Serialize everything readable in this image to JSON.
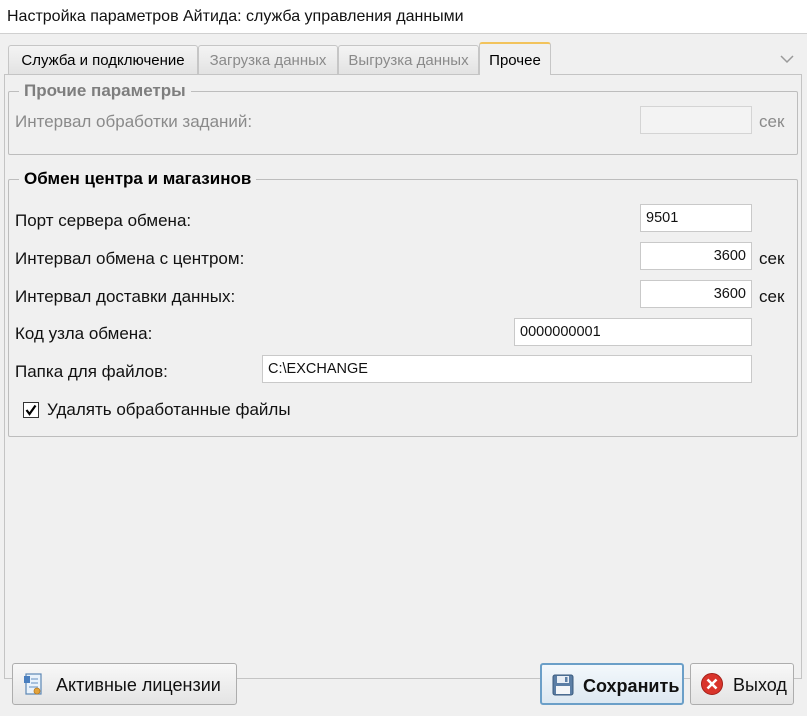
{
  "window": {
    "title": "Настройка параметров Айтида: служба управления данными"
  },
  "tabs": [
    {
      "label": "Служба и подключение"
    },
    {
      "label": "Загрузка данных"
    },
    {
      "label": "Выгрузка данных"
    },
    {
      "label": "Прочее"
    }
  ],
  "other_params": {
    "title": "Прочие параметры",
    "task_interval_label": "Интервал обработки заданий:",
    "task_interval_value": "",
    "unit": "сек"
  },
  "exchange": {
    "title": "Обмен центра и магазинов",
    "server_port_label": "Порт сервера обмена:",
    "server_port_value": "9501",
    "center_interval_label": "Интервал обмена с центром:",
    "center_interval_value": "3600",
    "delivery_interval_label": "Интервал доставки данных:",
    "delivery_interval_value": "3600",
    "unit": "сек",
    "node_code_label": "Код узла обмена:",
    "node_code_value": "0000000001",
    "folder_label": "Папка для файлов:",
    "folder_value": "C:\\EXCHANGE",
    "delete_processed_label": "Удалять обработанные файлы",
    "delete_processed_checked": true
  },
  "buttons": {
    "licenses": "Активные лицензии",
    "save": "Сохранить",
    "exit": "Выход"
  }
}
